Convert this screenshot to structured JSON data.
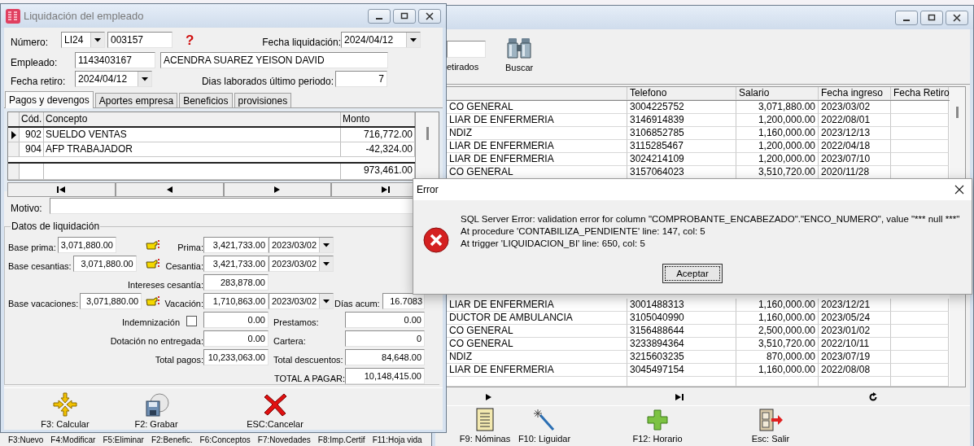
{
  "liquidacion_window": {
    "title": "Liquidación del empleado",
    "numero_label": "Número:",
    "serie": "LI24",
    "numero": "003157",
    "help_icon": "?",
    "fecha_liquidacion_label": "Fecha liquidación:",
    "fecha_liquidacion": "2024/04/12",
    "empleado_label": "Empleado:",
    "empleado_id": "1143403167",
    "empleado_nombre": "ACENDRA SUAREZ YEISON DAVID",
    "fecha_retiro_label": "Fecha retiro:",
    "fecha_retiro": "2024/04/12",
    "dias_label": "Dias laborados último periodo:",
    "dias": "7",
    "tabs": [
      {
        "label": "Pagos y devengos",
        "selected": true
      },
      {
        "label": "Aportes empresa",
        "selected": false
      },
      {
        "label": "Beneficios",
        "selected": false
      },
      {
        "label": "provisiones",
        "selected": false
      }
    ],
    "grid": {
      "columns": [
        "Cód.",
        "Concepto",
        "Monto"
      ],
      "rows": [
        {
          "cod": "902",
          "concepto": "SUELDO VENTAS",
          "monto": "716,772.00",
          "current": true
        },
        {
          "cod": "904",
          "concepto": "AFP TRABAJADOR",
          "monto": "-42,324.00",
          "current": false
        }
      ],
      "total": "973,461.00"
    },
    "motivo_label": "Motivo:",
    "datos": {
      "legend": "Datos de liquidación",
      "base_prima": {
        "label": "Base prima:",
        "value": "3,071,880.00"
      },
      "prima": {
        "label": "Prima:",
        "value": "3,421,733.00",
        "date": "2023/03/02"
      },
      "base_cesantias": {
        "label": "Base cesantias:",
        "value": "3,071,880.00"
      },
      "cesantia": {
        "label": "Cesantia:",
        "value": "3,421,733.00",
        "date": "2023/03/02"
      },
      "intereses": {
        "label": "Intereses cesantía:",
        "value": "283,878.00"
      },
      "base_vacaciones": {
        "label": "Base vacaciones:",
        "value": "3,071,880.00"
      },
      "vacacion": {
        "label": "Vacación:",
        "value": "1,710,863.00",
        "date": "2023/03/02"
      },
      "dias_acum": {
        "label": "Días acum:",
        "value": "16.7083"
      },
      "indemnizacion": {
        "label": "Indemnización",
        "checked": false,
        "value": "0.00"
      },
      "prestamos": {
        "label": "Prestamos:",
        "value": "0.00"
      },
      "dotacion": {
        "label": "Dotación no entregada:",
        "value": "0.00"
      },
      "cartera": {
        "label": "Cartera:",
        "value": "0"
      },
      "total_pagos": {
        "label": "Total pagos:",
        "value": "10,233,063.00"
      },
      "total_descuentos": {
        "label": "Total descuentos:",
        "value": "84,648.00"
      },
      "total_a_pagar": {
        "label": "TOTAL A PAGAR:",
        "value": "10,148,415.00"
      }
    },
    "buttons": [
      {
        "label": "F3: Calcular",
        "kind": "calcular"
      },
      {
        "label": "F2: Grabar",
        "kind": "grabar"
      },
      {
        "label": "ESC:Cancelar",
        "kind": "cancelar"
      }
    ]
  },
  "background_shortcuts": [
    "F3:Nuevo",
    "F4:Modificar",
    "F5:Eliminar",
    "F2:Benefic.",
    "F6:Conceptos",
    "F7:Novedades",
    "F8:Imp.Certif",
    "F11:Hoja vida"
  ],
  "employees_window": {
    "filter_label": "etirados",
    "search_button": "Buscar",
    "columns": [
      "Telefono",
      "Salario",
      "Fecha ingreso",
      "Fecha Retiro"
    ],
    "rows_above": [
      {
        "cargo": "CO GENERAL",
        "telefono": "3004225752",
        "salario": "3,071,880.00",
        "ingreso": "2023/03/02"
      },
      {
        "cargo": "LIAR DE ENFERMERIA",
        "telefono": "3146914839",
        "salario": "1,200,000.00",
        "ingreso": "2022/08/01"
      },
      {
        "cargo": "NDIZ",
        "telefono": "3106852785",
        "salario": "1,160,000.00",
        "ingreso": "2023/12/13"
      },
      {
        "cargo": "LIAR DE ENFERMERIA",
        "telefono": "3115285467",
        "salario": "1,200,000.00",
        "ingreso": "2022/04/18"
      },
      {
        "cargo": "LIAR DE ENFERMERIA",
        "telefono": "3024214109",
        "salario": "1,200,000.00",
        "ingreso": "2023/07/10"
      },
      {
        "cargo": "CO GENERAL",
        "telefono": "3157064023",
        "salario": "3,510,720.00",
        "ingreso": "2020/11/28"
      }
    ],
    "rows_below": [
      {
        "cargo": "LIAR DE ENFERMERIA",
        "telefono": "3001488313",
        "salario": "1,160,000.00",
        "ingreso": "2023/12/21"
      },
      {
        "cargo": "DUCTOR DE AMBULANCIA",
        "telefono": "3105040990",
        "salario": "1,160,000.00",
        "ingreso": "2023/05/24"
      },
      {
        "cargo": "CO GENERAL",
        "telefono": "3156488644",
        "salario": "2,500,000.00",
        "ingreso": "2023/01/02"
      },
      {
        "cargo": "CO GENERAL",
        "telefono": "3233894364",
        "salario": "3,510,720.00",
        "ingreso": "2022/10/11"
      },
      {
        "cargo": "NDIZ",
        "telefono": "3215603235",
        "salario": "870,000.00",
        "ingreso": "2023/07/19"
      },
      {
        "cargo": "LIAR DE ENFERMERIA",
        "telefono": "3045497154",
        "salario": "1,160,000.00",
        "ingreso": "2022/08/08"
      }
    ],
    "buttons": [
      {
        "label": "F9: Nóminas",
        "kind": "nominas"
      },
      {
        "label": "F10: Liguidar",
        "kind": "liquidar"
      },
      {
        "label": "F12: Horario",
        "kind": "horario"
      },
      {
        "label": "Esc: Salir",
        "kind": "salir"
      }
    ]
  },
  "error_dialog": {
    "title": "Error",
    "lines": [
      "SQL Server Error: validation error for column \"COMPROBANTE_ENCABEZADO\".\"ENCO_NUMERO\", value \"*** null ***\"",
      "At procedure 'CONTABILIZA_PENDIENTE' line: 147, col: 5",
      "At trigger 'LIQUIDACION_BI' line: 650, col: 5"
    ],
    "button": "Aceptar"
  }
}
